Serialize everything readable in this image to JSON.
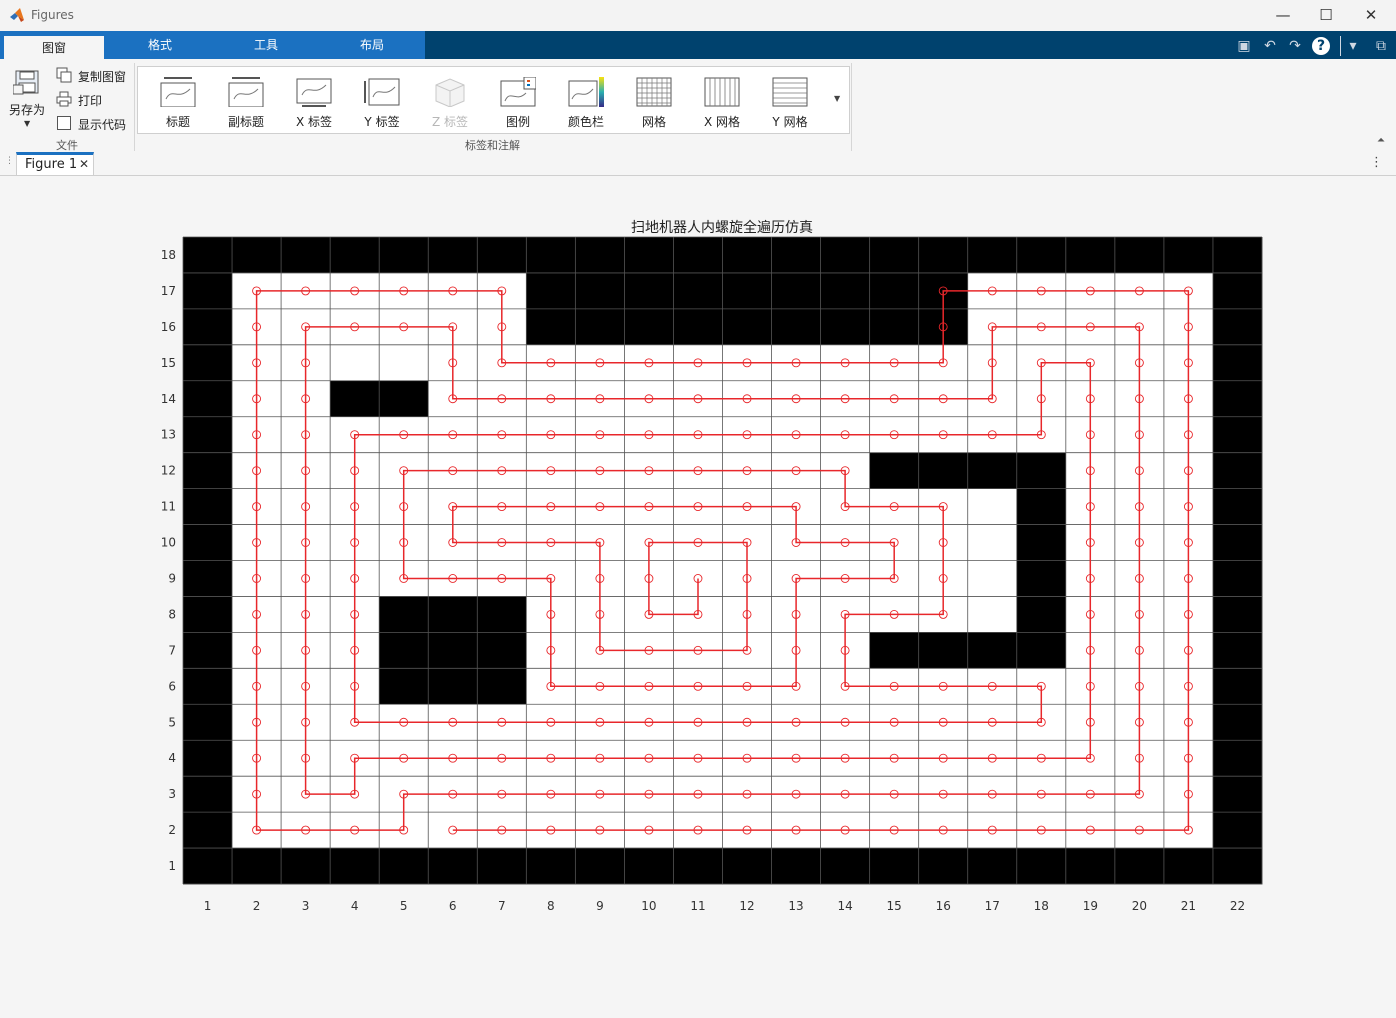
{
  "window": {
    "title": "Figures",
    "minimize_icon": "minimize-icon",
    "maximize_icon": "maximize-icon",
    "close_icon": "close-icon"
  },
  "ribbon_tabs": [
    {
      "label": "图窗",
      "active": true
    },
    {
      "label": "格式",
      "active": false
    },
    {
      "label": "工具",
      "active": false
    },
    {
      "label": "布局",
      "active": false
    }
  ],
  "file_group": {
    "save_as": "另存为",
    "copy_figure": "复制图窗",
    "print": "打印",
    "show_code": "显示代码",
    "label": "文件",
    "show_code_checked": false
  },
  "annotation_group": {
    "label": "标签和注解",
    "items": [
      {
        "label": "标题",
        "icon": "title-icon",
        "enabled": true
      },
      {
        "label": "副标题",
        "icon": "subtitle-icon",
        "enabled": true
      },
      {
        "label": "X 标签",
        "icon": "x-label-icon",
        "enabled": true
      },
      {
        "label": "Y 标签",
        "icon": "y-label-icon",
        "enabled": true
      },
      {
        "label": "Z 标签",
        "icon": "z-label-icon",
        "enabled": false
      },
      {
        "label": "图例",
        "icon": "legend-icon",
        "enabled": true
      },
      {
        "label": "颜色栏",
        "icon": "colorbar-icon",
        "enabled": true
      },
      {
        "label": "网格",
        "icon": "grid-icon",
        "enabled": true
      },
      {
        "label": "X 网格",
        "icon": "x-grid-icon",
        "enabled": true
      },
      {
        "label": "Y 网格",
        "icon": "y-grid-icon",
        "enabled": true
      }
    ]
  },
  "document_tabs": [
    {
      "label": "Figure 1",
      "closable": true
    }
  ],
  "chart_data": {
    "type": "scatter",
    "title": "扫地机器人内螺旋全遍历仿真",
    "xlabel": "",
    "ylabel": "",
    "xlim": [
      0.5,
      22.5
    ],
    "ylim": [
      0.5,
      18.5
    ],
    "xticks": [
      1,
      2,
      3,
      4,
      5,
      6,
      7,
      8,
      9,
      10,
      11,
      12,
      13,
      14,
      15,
      16,
      17,
      18,
      19,
      20,
      21,
      22
    ],
    "yticks": [
      1,
      2,
      3,
      4,
      5,
      6,
      7,
      8,
      9,
      10,
      11,
      12,
      13,
      14,
      15,
      16,
      17,
      18
    ],
    "grid": true,
    "colors": {
      "obstacle": "#000000",
      "free": "#ffffff",
      "path": "#e8272b",
      "gridline": "#555555"
    },
    "grid_map_note": "rows listed from y=18 (top) to y=1 (bottom); 1 = obstacle, 0 = free",
    "grid_map": [
      "1111111111111111111111",
      "1000000111111111000001",
      "1000000111111111000001",
      "1000000000000000000001",
      "1001100000000000000001",
      "1000000000000000000001",
      "1000000000000011110001",
      "1000000000000000010001",
      "1000000000000000010001",
      "1000000000000000010001",
      "1000111000000000010001",
      "1000111000000011110001",
      "1000111000000000000001",
      "1000000000000000000001",
      "1000000000000000000001",
      "1000000000000000000001",
      "1000000000000000000001",
      "1111111111111111111111"
    ],
    "path": [
      [
        6,
        2
      ],
      [
        7,
        2
      ],
      [
        8,
        2
      ],
      [
        9,
        2
      ],
      [
        10,
        2
      ],
      [
        11,
        2
      ],
      [
        12,
        2
      ],
      [
        13,
        2
      ],
      [
        14,
        2
      ],
      [
        15,
        2
      ],
      [
        16,
        2
      ],
      [
        17,
        2
      ],
      [
        18,
        2
      ],
      [
        19,
        2
      ],
      [
        20,
        2
      ],
      [
        21,
        2
      ],
      [
        21,
        3
      ],
      [
        21,
        4
      ],
      [
        21,
        5
      ],
      [
        21,
        6
      ],
      [
        21,
        7
      ],
      [
        21,
        8
      ],
      [
        21,
        9
      ],
      [
        21,
        10
      ],
      [
        21,
        11
      ],
      [
        21,
        12
      ],
      [
        21,
        13
      ],
      [
        21,
        14
      ],
      [
        21,
        15
      ],
      [
        21,
        16
      ],
      [
        21,
        17
      ],
      [
        20,
        17
      ],
      [
        19,
        17
      ],
      [
        18,
        17
      ],
      [
        17,
        17
      ],
      [
        16,
        17
      ],
      [
        16,
        16
      ],
      [
        16,
        15
      ],
      [
        15,
        15
      ],
      [
        14,
        15
      ],
      [
        13,
        15
      ],
      [
        12,
        15
      ],
      [
        11,
        15
      ],
      [
        10,
        15
      ],
      [
        9,
        15
      ],
      [
        8,
        15
      ],
      [
        7,
        15
      ],
      [
        7,
        16
      ],
      [
        7,
        17
      ],
      [
        6,
        17
      ],
      [
        5,
        17
      ],
      [
        4,
        17
      ],
      [
        3,
        17
      ],
      [
        2,
        17
      ],
      [
        2,
        16
      ],
      [
        2,
        15
      ],
      [
        2,
        14
      ],
      [
        2,
        13
      ],
      [
        2,
        12
      ],
      [
        2,
        11
      ],
      [
        2,
        10
      ],
      [
        2,
        9
      ],
      [
        2,
        8
      ],
      [
        2,
        7
      ],
      [
        2,
        6
      ],
      [
        2,
        5
      ],
      [
        2,
        4
      ],
      [
        2,
        3
      ],
      [
        2,
        2
      ],
      [
        3,
        2
      ],
      [
        4,
        2
      ],
      [
        5,
        2
      ],
      [
        5,
        3
      ],
      [
        6,
        3
      ],
      [
        7,
        3
      ],
      [
        8,
        3
      ],
      [
        9,
        3
      ],
      [
        10,
        3
      ],
      [
        11,
        3
      ],
      [
        12,
        3
      ],
      [
        13,
        3
      ],
      [
        14,
        3
      ],
      [
        15,
        3
      ],
      [
        16,
        3
      ],
      [
        17,
        3
      ],
      [
        18,
        3
      ],
      [
        19,
        3
      ],
      [
        20,
        3
      ],
      [
        20,
        4
      ],
      [
        20,
        5
      ],
      [
        20,
        6
      ],
      [
        20,
        7
      ],
      [
        20,
        8
      ],
      [
        20,
        9
      ],
      [
        20,
        10
      ],
      [
        20,
        11
      ],
      [
        20,
        12
      ],
      [
        20,
        13
      ],
      [
        20,
        14
      ],
      [
        20,
        15
      ],
      [
        20,
        16
      ],
      [
        19,
        16
      ],
      [
        18,
        16
      ],
      [
        17,
        16
      ],
      [
        17,
        15
      ],
      [
        17,
        14
      ],
      [
        16,
        14
      ],
      [
        15,
        14
      ],
      [
        14,
        14
      ],
      [
        13,
        14
      ],
      [
        12,
        14
      ],
      [
        11,
        14
      ],
      [
        10,
        14
      ],
      [
        9,
        14
      ],
      [
        8,
        14
      ],
      [
        7,
        14
      ],
      [
        6,
        14
      ],
      [
        6,
        15
      ],
      [
        6,
        16
      ],
      [
        5,
        16
      ],
      [
        4,
        16
      ],
      [
        3,
        16
      ],
      [
        3,
        15
      ],
      [
        3,
        14
      ],
      [
        3,
        13
      ],
      [
        3,
        12
      ],
      [
        3,
        11
      ],
      [
        3,
        10
      ],
      [
        3,
        9
      ],
      [
        3,
        8
      ],
      [
        3,
        7
      ],
      [
        3,
        6
      ],
      [
        3,
        5
      ],
      [
        3,
        4
      ],
      [
        3,
        3
      ],
      [
        4,
        3
      ],
      [
        4,
        4
      ],
      [
        5,
        4
      ],
      [
        6,
        4
      ],
      [
        7,
        4
      ],
      [
        8,
        4
      ],
      [
        9,
        4
      ],
      [
        10,
        4
      ],
      [
        11,
        4
      ],
      [
        12,
        4
      ],
      [
        13,
        4
      ],
      [
        14,
        4
      ],
      [
        15,
        4
      ],
      [
        16,
        4
      ],
      [
        17,
        4
      ],
      [
        18,
        4
      ],
      [
        19,
        4
      ],
      [
        19,
        5
      ],
      [
        19,
        6
      ],
      [
        19,
        7
      ],
      [
        19,
        8
      ],
      [
        19,
        9
      ],
      [
        19,
        10
      ],
      [
        19,
        11
      ],
      [
        19,
        12
      ],
      [
        19,
        13
      ],
      [
        19,
        14
      ],
      [
        19,
        15
      ],
      [
        18,
        15
      ],
      [
        18,
        14
      ],
      [
        18,
        13
      ],
      [
        17,
        13
      ],
      [
        16,
        13
      ],
      [
        15,
        13
      ],
      [
        14,
        13
      ],
      [
        13,
        13
      ],
      [
        12,
        13
      ],
      [
        11,
        13
      ],
      [
        10,
        13
      ],
      [
        9,
        13
      ],
      [
        8,
        13
      ],
      [
        7,
        13
      ],
      [
        6,
        13
      ],
      [
        5,
        13
      ],
      [
        4,
        13
      ],
      [
        4,
        12
      ],
      [
        4,
        11
      ],
      [
        4,
        10
      ],
      [
        4,
        9
      ],
      [
        4,
        8
      ],
      [
        4,
        7
      ],
      [
        4,
        6
      ],
      [
        4,
        5
      ],
      [
        5,
        5
      ],
      [
        6,
        5
      ],
      [
        7,
        5
      ],
      [
        8,
        5
      ],
      [
        9,
        5
      ],
      [
        10,
        5
      ],
      [
        11,
        5
      ],
      [
        12,
        5
      ],
      [
        13,
        5
      ],
      [
        14,
        5
      ],
      [
        15,
        5
      ],
      [
        16,
        5
      ],
      [
        17,
        5
      ],
      [
        18,
        5
      ],
      [
        18,
        6
      ],
      [
        17,
        6
      ],
      [
        16,
        6
      ],
      [
        15,
        6
      ],
      [
        14,
        6
      ],
      [
        14,
        7
      ],
      [
        14,
        8
      ],
      [
        15,
        8
      ],
      [
        16,
        8
      ],
      [
        16,
        9
      ],
      [
        16,
        10
      ],
      [
        16,
        11
      ],
      [
        15,
        11
      ],
      [
        14,
        11
      ],
      [
        14,
        12
      ],
      [
        13,
        12
      ],
      [
        12,
        12
      ],
      [
        11,
        12
      ],
      [
        10,
        12
      ],
      [
        9,
        12
      ],
      [
        8,
        12
      ],
      [
        7,
        12
      ],
      [
        6,
        12
      ],
      [
        5,
        12
      ],
      [
        5,
        11
      ],
      [
        5,
        10
      ],
      [
        5,
        9
      ],
      [
        6,
        9
      ],
      [
        7,
        9
      ],
      [
        8,
        9
      ],
      [
        8,
        8
      ],
      [
        8,
        7
      ],
      [
        8,
        6
      ],
      [
        9,
        6
      ],
      [
        10,
        6
      ],
      [
        11,
        6
      ],
      [
        12,
        6
      ],
      [
        13,
        6
      ],
      [
        13,
        7
      ],
      [
        13,
        8
      ],
      [
        13,
        9
      ],
      [
        14,
        9
      ],
      [
        15,
        9
      ],
      [
        15,
        10
      ],
      [
        14,
        10
      ],
      [
        13,
        10
      ],
      [
        13,
        11
      ],
      [
        12,
        11
      ],
      [
        11,
        11
      ],
      [
        10,
        11
      ],
      [
        9,
        11
      ],
      [
        8,
        11
      ],
      [
        7,
        11
      ],
      [
        6,
        11
      ],
      [
        6,
        10
      ],
      [
        7,
        10
      ],
      [
        8,
        10
      ],
      [
        9,
        10
      ],
      [
        9,
        9
      ],
      [
        9,
        8
      ],
      [
        9,
        7
      ],
      [
        10,
        7
      ],
      [
        11,
        7
      ],
      [
        12,
        7
      ],
      [
        12,
        8
      ],
      [
        12,
        9
      ],
      [
        12,
        10
      ],
      [
        11,
        10
      ],
      [
        10,
        10
      ],
      [
        10,
        9
      ],
      [
        10,
        8
      ],
      [
        11,
        8
      ],
      [
        11,
        9
      ]
    ]
  }
}
